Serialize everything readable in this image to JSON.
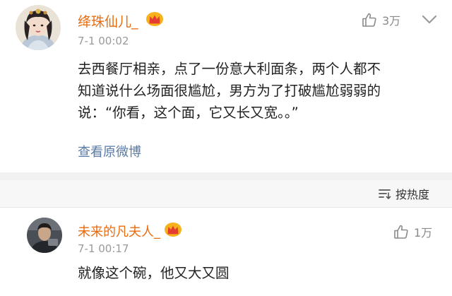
{
  "comments": [
    {
      "username": "绛珠仙儿_",
      "timestamp": "7-1 00:02",
      "like_count": "3万",
      "text_lines": [
        "去西餐厅相亲，点了一份意大利面条，两个人都不",
        "知道说什么场面很尴尬，男方为了打破尴尬弱弱的",
        "说：“你看，这个面，它又长又宽。。”"
      ],
      "view_original_label": "查看原微博",
      "more_icon": "chevron-down-icon",
      "like_icon": "thumbs-up-icon",
      "badge_icon": "crown-icon"
    },
    {
      "username": "未来的凡夫人_",
      "timestamp": "7-1 00:17",
      "like_count": "1万",
      "text": "就像这个碗，他又大又圆",
      "like_icon": "thumbs-up-icon",
      "badge_icon": "crown-icon"
    }
  ],
  "sort": {
    "label": "按热度",
    "icon": "sort-icon"
  },
  "colors": {
    "username": "#e86b0f",
    "link": "#5a7aa6",
    "timestamp": "#9a9a9a",
    "separator": "#f1f1f1"
  }
}
